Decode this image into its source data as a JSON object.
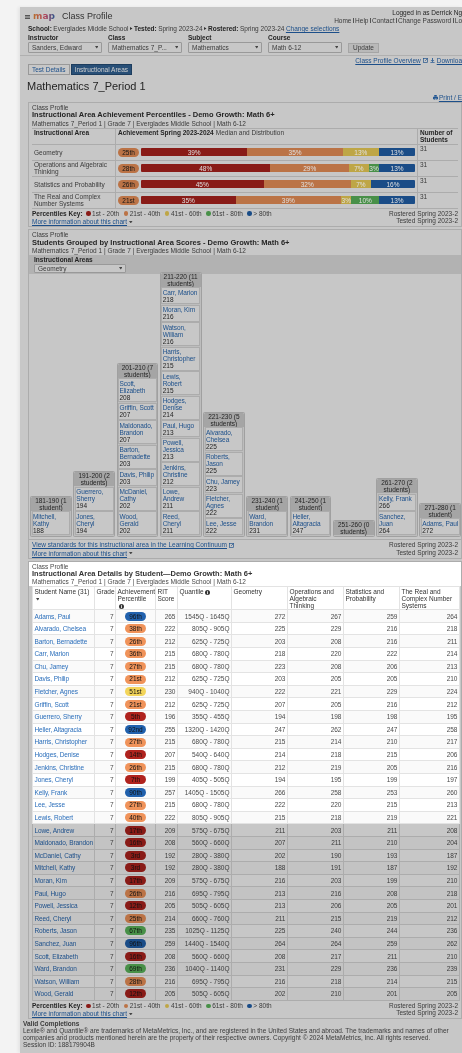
{
  "header": {
    "logo": "map",
    "title": "Class Profile",
    "user": "Logged in as Derrick Ng",
    "links": [
      "Home",
      "Help",
      "Contact",
      "Change Password",
      "Lo"
    ]
  },
  "context": {
    "parts": [
      {
        "label": "School:",
        "value": "Everglades Middle School"
      },
      {
        "label": "Tested:",
        "value": "Spring 2023-24"
      },
      {
        "label": "Rostered:",
        "value": "Spring 2023-24"
      }
    ],
    "link": "Change selections"
  },
  "filters": [
    {
      "label": "Instructor",
      "value": "Sanders, Edward"
    },
    {
      "label": "Class",
      "value": "Mathematics 7_P..."
    },
    {
      "label": "Subject",
      "value": "Mathematics"
    },
    {
      "label": "Course",
      "value": "Math 6-12"
    }
  ],
  "update_button": "Update",
  "actions": {
    "overview": "Class Profile Overview",
    "download": "Downloa"
  },
  "tabs": [
    {
      "label": "Test Details",
      "selected": false
    },
    {
      "label": "Instructional Areas",
      "selected": true
    }
  ],
  "page_title": "Mathematics 7_Period 1",
  "print": "Print / E",
  "achievement": {
    "eyebrow": "Class Profile",
    "title": "Instructional Area Achievement Percentiles - Demo Growth: Math 6+",
    "subtitle": "Mathematics 7_Period 1 | Grade 7 | Everglades Middle School | Math 6-12",
    "columns": [
      "Instructional Area",
      "Achievement Spring 2023-2024",
      "Median and Distribution",
      "Number of Students"
    ],
    "rows": [
      {
        "area": "Geometry",
        "median": {
          "label": "25th",
          "color": "#bb7346"
        },
        "students": "31",
        "segments": [
          {
            "label": "39%",
            "color": "#891b17"
          },
          {
            "label": "35%",
            "color": "#bb7346"
          },
          {
            "label": "13%",
            "color": "#bea646"
          },
          {
            "label": "13%",
            "color": "#1a4c87"
          }
        ]
      },
      {
        "area": "Operations and Algebraic Thinking",
        "median": {
          "label": "28th",
          "color": "#bb7346"
        },
        "students": "31",
        "segments": [
          {
            "label": "48%",
            "color": "#891b17"
          },
          {
            "label": "29%",
            "color": "#bb7346"
          },
          {
            "label": "7%",
            "color": "#bea646"
          },
          {
            "label": "3%",
            "color": "#489048"
          },
          {
            "label": "13%",
            "color": "#1a4c87"
          }
        ]
      },
      {
        "area": "Statistics and Probability",
        "median": {
          "label": "26th",
          "color": "#bb7346"
        },
        "students": "31",
        "segments": [
          {
            "label": "45%",
            "color": "#891b17"
          },
          {
            "label": "32%",
            "color": "#bb7346"
          },
          {
            "label": "7%",
            "color": "#bea646"
          },
          {
            "label": "16%",
            "color": "#1a4c87"
          }
        ]
      },
      {
        "area": "The Real and Complex Number Systems",
        "median": {
          "label": "21st",
          "color": "#bb7346"
        },
        "students": "31",
        "segments": [
          {
            "label": "35%",
            "color": "#891b17"
          },
          {
            "label": "39%",
            "color": "#bb7346"
          },
          {
            "label": "3%",
            "color": "#bea646"
          },
          {
            "label": "10%",
            "color": "#489048"
          },
          {
            "label": "13%",
            "color": "#1a4c87"
          }
        ]
      }
    ],
    "key_label": "Percentiles Key:",
    "key": [
      {
        "label": "1st - 20th",
        "color": "#891b17"
      },
      {
        "label": "21st - 40th",
        "color": "#bb7346"
      },
      {
        "label": "41st - 60th",
        "color": "#bea646"
      },
      {
        "label": "61st - 80th",
        "color": "#489048"
      },
      {
        "label": "> 80th",
        "color": "#1a4c87"
      }
    ],
    "dates": [
      "Rostered Spring 2023-2",
      "Tested Spring 2023-2"
    ],
    "more": "More information about this chart"
  },
  "groups": {
    "eyebrow": "Class Profile",
    "title": "Students Grouped by Instructional Area Scores - Demo Growth: Math 6+",
    "subtitle": "Mathematics 7_Period 1 | Grade 7 | Everglades Middle School | Math 6-12",
    "filter_label": "Instructional Areas",
    "filter_value": "Geometry",
    "bins": [
      {
        "header": "181-190 (1 student)",
        "students": [
          {
            "name": "Mitchell, Kathy",
            "score": "188"
          }
        ]
      },
      {
        "header": "191-200 (2 students)",
        "students": [
          {
            "name": "Guerrero, Sherry",
            "score": "194"
          },
          {
            "name": "Jones, Cheryl",
            "score": "194"
          }
        ]
      },
      {
        "header": "201-210 (7 students)",
        "students": [
          {
            "name": "Scott, Elizabeth",
            "score": "208"
          },
          {
            "name": "Griffin, Scott",
            "score": "207"
          },
          {
            "name": "Maldonado, Brandon",
            "score": "207"
          },
          {
            "name": "Barton, Bernadette",
            "score": "203"
          },
          {
            "name": "Davis, Philip",
            "score": "203"
          },
          {
            "name": "McDaniel, Cathy",
            "score": "202"
          },
          {
            "name": "Wood, Gerald",
            "score": "202"
          }
        ]
      },
      {
        "header": "211-220 (11 students)",
        "students": [
          {
            "name": "Carr, Marion",
            "score": "218"
          },
          {
            "name": "Moran, Kim",
            "score": "216"
          },
          {
            "name": "Watson, William",
            "score": "216"
          },
          {
            "name": "Harris, Christopher",
            "score": "215"
          },
          {
            "name": "Lewis, Robert",
            "score": "215"
          },
          {
            "name": "Hodges, Denise",
            "score": "214"
          },
          {
            "name": "Paul, Hugo",
            "score": "213"
          },
          {
            "name": "Powell, Jessica",
            "score": "213"
          },
          {
            "name": "Jenkins, Christine",
            "score": "212"
          },
          {
            "name": "Lowe, Andrew",
            "score": "211"
          },
          {
            "name": "Reed, Cheryl",
            "score": "211"
          }
        ]
      },
      {
        "header": "221-230 (5 students)",
        "students": [
          {
            "name": "Alvarado, Chelsea",
            "score": "225"
          },
          {
            "name": "Roberts, Jason",
            "score": "225"
          },
          {
            "name": "Chu, Jamey",
            "score": "223"
          },
          {
            "name": "Fletcher, Agnes",
            "score": "222"
          },
          {
            "name": "Lee, Jesse",
            "score": "222"
          }
        ]
      },
      {
        "header": "231-240 (1 student)",
        "students": [
          {
            "name": "Ward, Brandon",
            "score": "231"
          }
        ]
      },
      {
        "header": "241-250 (1 student)",
        "students": [
          {
            "name": "Heller, Altagracia",
            "score": "247"
          }
        ]
      },
      {
        "header": "251-260 (0 students)"
      },
      {
        "header": "261-270 (2 students)",
        "students": [
          {
            "name": "Kelly, Frank",
            "score": "266"
          },
          {
            "name": "Sanchez, Juan",
            "score": "264"
          }
        ]
      },
      {
        "header": "271-280 (1 student)",
        "students": [
          {
            "name": "Adams, Paul",
            "score": "272"
          }
        ]
      }
    ],
    "standards_link": "View standards for this instructional area in the Learning Continuum",
    "more": "More information about this chart",
    "dates": [
      "Rostered Spring 2023-2",
      "Tested Spring 2023-2"
    ]
  },
  "details": {
    "eyebrow": "Class Profile",
    "title": "Instructional Area Details by Student—Demo Growth: Math 6+",
    "subtitle": "Mathematics 7_Period 1 | Grade 7 | Everglades Middle School | Math 6-12",
    "columns": [
      "Student Name (31)",
      "Grade",
      "Achievement Percentile",
      "RIT Score",
      "Quantile",
      "Geometry",
      "Operations and Algebraic Thinking",
      "Statistics and Probability",
      "The Real and Complex Number Systems"
    ],
    "rows": [
      {
        "highlighted": true,
        "name": "Adams, Paul",
        "grade": "7",
        "percentile": "96th",
        "color": "#2161ad",
        "rit": "265",
        "quantile": "1545Q - 1645Q",
        "scores": [
          "272",
          "267",
          "259",
          "264"
        ]
      },
      {
        "highlighted": true,
        "name": "Alvarado, Chelsea",
        "grade": "7",
        "percentile": "38th",
        "color": "#f0935a",
        "rit": "222",
        "quantile": "805Q - 905Q",
        "scores": [
          "225",
          "229",
          "216",
          "218"
        ]
      },
      {
        "highlighted": true,
        "name": "Barton, Bernadette",
        "grade": "7",
        "percentile": "26th",
        "color": "#f0935a",
        "rit": "212",
        "quantile": "625Q - 725Q",
        "scores": [
          "203",
          "208",
          "216",
          "211"
        ]
      },
      {
        "highlighted": true,
        "name": "Carr, Marion",
        "grade": "7",
        "percentile": "36th",
        "color": "#f0935a",
        "rit": "215",
        "quantile": "680Q - 780Q",
        "scores": [
          "218",
          "220",
          "222",
          "214"
        ]
      },
      {
        "highlighted": true,
        "name": "Chu, Jamey",
        "grade": "7",
        "percentile": "27th",
        "color": "#f0935a",
        "rit": "215",
        "quantile": "680Q - 780Q",
        "scores": [
          "223",
          "208",
          "206",
          "213"
        ]
      },
      {
        "highlighted": true,
        "name": "Davis, Philip",
        "grade": "7",
        "percentile": "21st",
        "color": "#f0935a",
        "rit": "212",
        "quantile": "625Q - 725Q",
        "scores": [
          "203",
          "205",
          "205",
          "210"
        ]
      },
      {
        "highlighted": true,
        "name": "Fletcher, Agnes",
        "grade": "7",
        "percentile": "51st",
        "color": "#f3d55a",
        "rit": "230",
        "quantile": "940Q - 1040Q",
        "scores": [
          "222",
          "221",
          "229",
          "224"
        ]
      },
      {
        "highlighted": true,
        "name": "Griffin, Scott",
        "grade": "7",
        "percentile": "21st",
        "color": "#f0935a",
        "rit": "212",
        "quantile": "625Q - 725Q",
        "scores": [
          "207",
          "205",
          "216",
          "212"
        ]
      },
      {
        "highlighted": true,
        "name": "Guerrero, Sherry",
        "grade": "7",
        "percentile": "5th",
        "color": "#b0231e",
        "rit": "196",
        "quantile": "355Q - 455Q",
        "scores": [
          "194",
          "198",
          "198",
          "195"
        ]
      },
      {
        "highlighted": true,
        "name": "Heller, Altagracia",
        "grade": "7",
        "percentile": "92nd",
        "color": "#2161ad",
        "rit": "255",
        "quantile": "1320Q - 1420Q",
        "scores": [
          "247",
          "262",
          "247",
          "258"
        ]
      },
      {
        "highlighted": true,
        "name": "Harris, Christopher",
        "grade": "7",
        "percentile": "27th",
        "color": "#f0935a",
        "rit": "215",
        "quantile": "680Q - 780Q",
        "scores": [
          "215",
          "214",
          "210",
          "217"
        ]
      },
      {
        "highlighted": true,
        "name": "Hodges, Denise",
        "grade": "7",
        "percentile": "14th",
        "color": "#b0231e",
        "rit": "207",
        "quantile": "540Q - 640Q",
        "scores": [
          "214",
          "218",
          "215",
          "206"
        ]
      },
      {
        "highlighted": true,
        "name": "Jenkins, Christine",
        "grade": "7",
        "percentile": "26th",
        "color": "#f0935a",
        "rit": "215",
        "quantile": "680Q - 780Q",
        "scores": [
          "212",
          "219",
          "205",
          "216"
        ]
      },
      {
        "highlighted": true,
        "name": "Jones, Cheryl",
        "grade": "7",
        "percentile": "7th",
        "color": "#b0231e",
        "rit": "199",
        "quantile": "405Q - 505Q",
        "scores": [
          "194",
          "195",
          "199",
          "197"
        ]
      },
      {
        "highlighted": true,
        "name": "Kelly, Frank",
        "grade": "7",
        "percentile": "90th",
        "color": "#2161ad",
        "rit": "257",
        "quantile": "1405Q - 1505Q",
        "scores": [
          "266",
          "258",
          "253",
          "260"
        ]
      },
      {
        "highlighted": true,
        "name": "Lee, Jesse",
        "grade": "7",
        "percentile": "27th",
        "color": "#f0935a",
        "rit": "215",
        "quantile": "680Q - 780Q",
        "scores": [
          "222",
          "220",
          "215",
          "213"
        ]
      },
      {
        "highlighted": true,
        "name": "Lewis, Robert",
        "grade": "7",
        "percentile": "40th",
        "color": "#f0935a",
        "rit": "222",
        "quantile": "805Q - 905Q",
        "scores": [
          "215",
          "218",
          "219",
          "221"
        ]
      },
      {
        "highlighted": false,
        "name": "Lowe, Andrew",
        "grade": "7",
        "percentile": "17th",
        "color": "#891b17",
        "rit": "209",
        "quantile": "575Q - 675Q",
        "scores": [
          "211",
          "203",
          "211",
          "208"
        ]
      },
      {
        "highlighted": false,
        "name": "Maldonado, Brandon",
        "grade": "7",
        "percentile": "16th",
        "color": "#891b17",
        "rit": "208",
        "quantile": "560Q - 660Q",
        "scores": [
          "207",
          "211",
          "210",
          "204"
        ]
      },
      {
        "highlighted": false,
        "name": "McDaniel, Cathy",
        "grade": "7",
        "percentile": "3rd",
        "color": "#891b17",
        "rit": "192",
        "quantile": "280Q - 380Q",
        "scores": [
          "202",
          "190",
          "193",
          "187"
        ]
      },
      {
        "highlighted": false,
        "name": "Mitchell, Kathy",
        "grade": "7",
        "percentile": "3rd",
        "color": "#891b17",
        "rit": "192",
        "quantile": "280Q - 380Q",
        "scores": [
          "188",
          "191",
          "187",
          "192"
        ]
      },
      {
        "highlighted": false,
        "name": "Moran, Kim",
        "grade": "7",
        "percentile": "17th",
        "color": "#891b17",
        "rit": "209",
        "quantile": "575Q - 675Q",
        "scores": [
          "216",
          "203",
          "199",
          "210"
        ]
      },
      {
        "highlighted": false,
        "name": "Paul, Hugo",
        "grade": "7",
        "percentile": "26th",
        "color": "#bb7346",
        "rit": "216",
        "quantile": "695Q - 795Q",
        "scores": [
          "213",
          "216",
          "208",
          "218"
        ]
      },
      {
        "highlighted": false,
        "name": "Powell, Jessica",
        "grade": "7",
        "percentile": "12th",
        "color": "#891b17",
        "rit": "205",
        "quantile": "505Q - 605Q",
        "scores": [
          "213",
          "206",
          "205",
          "201"
        ]
      },
      {
        "highlighted": false,
        "name": "Reed, Cheryl",
        "grade": "7",
        "percentile": "25th",
        "color": "#bb7346",
        "rit": "214",
        "quantile": "660Q - 760Q",
        "scores": [
          "211",
          "215",
          "219",
          "212"
        ]
      },
      {
        "highlighted": false,
        "name": "Roberts, Jason",
        "grade": "7",
        "percentile": "67th",
        "color": "#489048",
        "rit": "235",
        "quantile": "1025Q - 1125Q",
        "scores": [
          "225",
          "240",
          "244",
          "236"
        ]
      },
      {
        "highlighted": false,
        "name": "Sanchez, Juan",
        "grade": "7",
        "percentile": "96th",
        "color": "#1a4c87",
        "rit": "259",
        "quantile": "1440Q - 1540Q",
        "scores": [
          "264",
          "264",
          "259",
          "262"
        ]
      },
      {
        "highlighted": false,
        "name": "Scott, Elizabeth",
        "grade": "7",
        "percentile": "16th",
        "color": "#891b17",
        "rit": "208",
        "quantile": "560Q - 660Q",
        "scores": [
          "208",
          "217",
          "211",
          "210"
        ]
      },
      {
        "highlighted": false,
        "name": "Ward, Brandon",
        "grade": "7",
        "percentile": "69th",
        "color": "#489048",
        "rit": "236",
        "quantile": "1040Q - 1140Q",
        "scores": [
          "231",
          "229",
          "236",
          "239"
        ]
      },
      {
        "highlighted": false,
        "name": "Watson, William",
        "grade": "7",
        "percentile": "28th",
        "color": "#bb7346",
        "rit": "216",
        "quantile": "695Q - 795Q",
        "scores": [
          "216",
          "218",
          "214",
          "215"
        ]
      },
      {
        "highlighted": false,
        "name": "Wood, Gerald",
        "grade": "7",
        "percentile": "12th",
        "color": "#891b17",
        "rit": "205",
        "quantile": "505Q - 605Q",
        "scores": [
          "202",
          "210",
          "201",
          "205"
        ]
      }
    ],
    "key_label": "Percentiles Key:",
    "key": [
      {
        "label": "1st - 20th",
        "color": "#891b17"
      },
      {
        "label": "21st - 40th",
        "color": "#bb7346"
      },
      {
        "label": "41st - 60th",
        "color": "#bea646"
      },
      {
        "label": "61st - 80th",
        "color": "#489048"
      },
      {
        "label": "> 80th",
        "color": "#1a4c87"
      }
    ],
    "dates": [
      "Rostered Spring 2023-2",
      "Tested Spring 2023-2"
    ],
    "more": "More information about this chart"
  },
  "footer": {
    "heading": "Valid Completions",
    "notice": "Lexile® and Quantile® are trademarks of MetaMetrics, Inc., and are registered in the United States and abroad. The trademarks and names of other companies and products mentioned herein are the property of their respective owners. Copyright © 2024 MetaMetrics, Inc. All rights reserved.",
    "session": "Session ID: 188179904B"
  }
}
